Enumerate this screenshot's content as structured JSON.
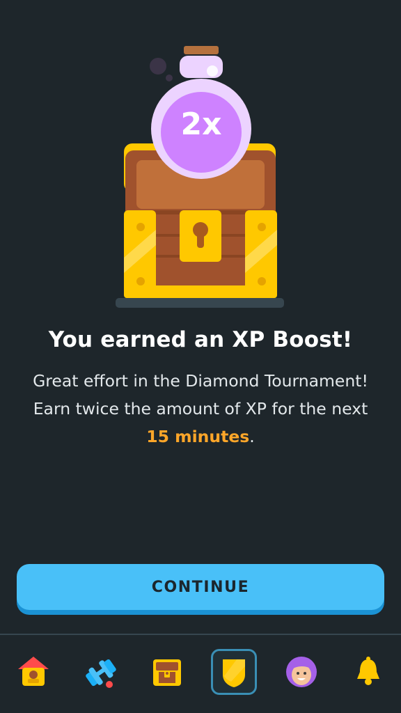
{
  "boost": {
    "multiplier_label": "2x",
    "title": "You earned an XP Boost!",
    "message_before": "Great effort in the Diamond Tournament! Earn twice the amount of XP for the next ",
    "message_highlight": "15 minutes",
    "message_after": "."
  },
  "actions": {
    "continue_label": "CONTINUE"
  },
  "tabbar": {
    "items": [
      {
        "name": "home",
        "icon": "house-icon",
        "active": false
      },
      {
        "name": "practice",
        "icon": "dumbbell-icon",
        "active": false
      },
      {
        "name": "shop",
        "icon": "treasure-chest-icon",
        "active": false
      },
      {
        "name": "leagues",
        "icon": "shield-icon",
        "active": true
      },
      {
        "name": "profile",
        "icon": "avatar-icon",
        "active": false
      },
      {
        "name": "notifications",
        "icon": "bell-icon",
        "active": false
      }
    ]
  },
  "colors": {
    "background": "#1e262b",
    "accent_blue": "#49c0f8",
    "highlight_orange": "#ffa629",
    "chest_gold": "#ffc800",
    "chest_wood": "#a0522d",
    "potion_purple": "#ce82ff"
  }
}
